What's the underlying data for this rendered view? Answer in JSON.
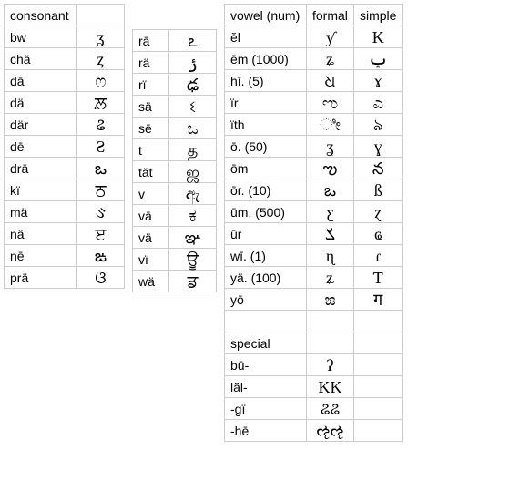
{
  "consonant": {
    "header": "consonant",
    "rows": [
      {
        "label": "bw",
        "glyph": "ʓ"
      },
      {
        "label": "chä",
        "glyph": "ȥ"
      },
      {
        "label": "dā",
        "glyph": "ෆ"
      },
      {
        "label": "dä",
        "glyph": "ਲ਼"
      },
      {
        "label": "där",
        "glyph": "ଌ"
      },
      {
        "label": "dē",
        "glyph": "Ƨ"
      },
      {
        "label": "drā",
        "glyph": "ఒ"
      },
      {
        "label": "kï",
        "glyph": "ਠ"
      },
      {
        "label": "mä",
        "glyph": "ઙ"
      },
      {
        "label": "nä",
        "glyph": "ੲ"
      },
      {
        "label": "nē",
        "glyph": "ఙ"
      },
      {
        "label": "prä",
        "glyph": "ଓ"
      }
    ]
  },
  "consonant2": {
    "rows": [
      {
        "label": "rā",
        "glyph": "ఽ"
      },
      {
        "label": "rä",
        "glyph": "ݬ"
      },
      {
        "label": "rï",
        "glyph": "ఢ"
      },
      {
        "label": "sä",
        "glyph": "ଽ"
      },
      {
        "label": "sē",
        "glyph": "ಒ"
      },
      {
        "label": "t",
        "glyph": "த"
      },
      {
        "label": "tät",
        "glyph": "ஜ"
      },
      {
        "label": "v",
        "glyph": "ඇ"
      },
      {
        "label": "vā",
        "glyph": "ಕ"
      },
      {
        "label": "vä",
        "glyph": "ఞ"
      },
      {
        "label": "vï",
        "glyph": "ਊ"
      },
      {
        "label": "wä",
        "glyph": "ਡ"
      }
    ]
  },
  "vowel": {
    "headers": [
      "vowel (num)",
      "formal",
      "simple"
    ],
    "rows": [
      {
        "label": "ĕl",
        "formal": "ƴ",
        "simple": "K"
      },
      {
        "label": "ēm (1000)",
        "formal": "ʑ",
        "simple": "ݕ"
      },
      {
        "label": "hī. (5)",
        "formal": "ଧ",
        "simple": "ɤ"
      },
      {
        "label": "ïr",
        "formal": "ಌ",
        "simple": "ಎ"
      },
      {
        "label": "ïth",
        "formal": "ೀ",
        "simple": "৯"
      },
      {
        "label": "ō. (50)",
        "formal": "ʓ",
        "simple": "ɣ"
      },
      {
        "label": "ōm",
        "formal": "ఌ",
        "simple": "న"
      },
      {
        "label": "ōr. (10)",
        "formal": "ఒ",
        "simple": "ß"
      },
      {
        "label": "ūm. (500)",
        "formal": "ƹ",
        "simple": "ɀ"
      },
      {
        "label": "ūr",
        "formal": "ݎ",
        "simple": "ҩ"
      },
      {
        "label": "wī. (1)",
        "formal": "ɳ",
        "simple": "ɾ"
      },
      {
        "label": "yä. (100)",
        "formal": "ʑ",
        "simple": "Ƭ"
      },
      {
        "label": "yō",
        "formal": "ಙ",
        "simple": "ग"
      }
    ]
  },
  "special": {
    "header": "special",
    "rows": [
      {
        "label": "bū-",
        "formal": "ʔ",
        "simple": ""
      },
      {
        "label": "lăl-",
        "formal": "KK",
        "simple": ""
      },
      {
        "label": "-gï",
        "formal": "ଌଌ",
        "simple": ""
      },
      {
        "label": "-hē",
        "formal": "ૡૡ",
        "simple": ""
      }
    ]
  }
}
